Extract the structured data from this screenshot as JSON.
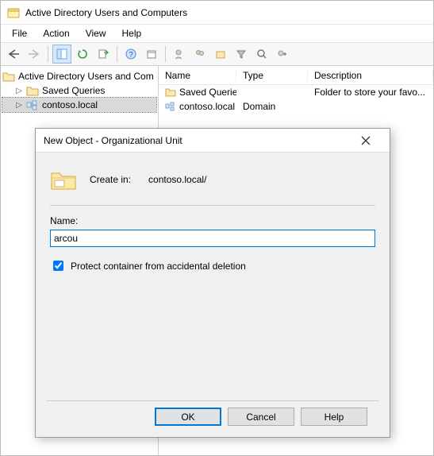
{
  "app": {
    "title": "Active Directory Users and Computers"
  },
  "menus": {
    "file": "File",
    "action": "Action",
    "view": "View",
    "help": "Help"
  },
  "tree": {
    "root": "Active Directory Users and Com",
    "node1": "Saved Queries",
    "node2": "contoso.local"
  },
  "list": {
    "headers": {
      "name": "Name",
      "type": "Type",
      "desc": "Description"
    },
    "rows": [
      {
        "name": "Saved Queries",
        "type": "",
        "desc": "Folder to store your favo..."
      },
      {
        "name": "contoso.local",
        "type": "Domain",
        "desc": ""
      }
    ]
  },
  "dialog": {
    "title": "New Object - Organizational Unit",
    "create_in_label": "Create in:",
    "create_in_path": "contoso.local/",
    "name_label": "Name:",
    "name_value": "arcou",
    "protect_label": "Protect container from accidental deletion",
    "protect_checked": true,
    "ok": "OK",
    "cancel": "Cancel",
    "help": "Help"
  }
}
